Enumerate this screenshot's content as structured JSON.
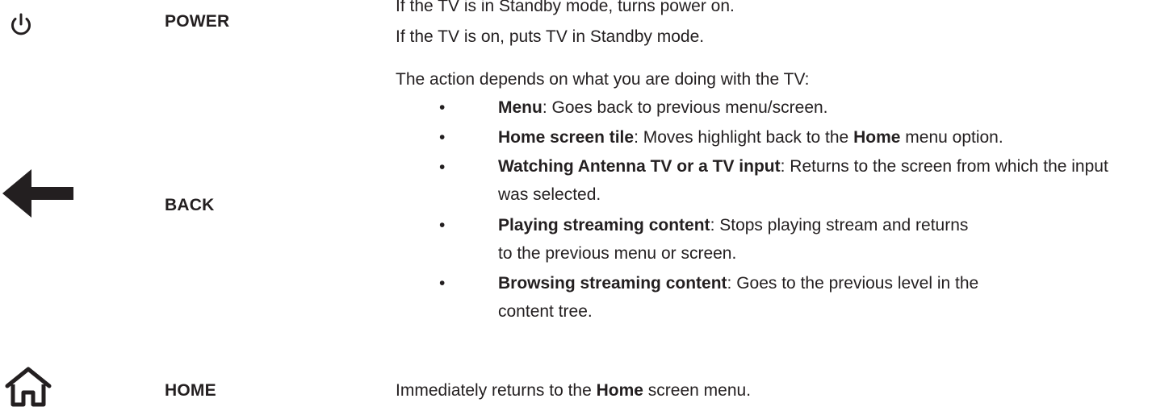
{
  "rows": {
    "power": {
      "icon": "power-icon",
      "label": "POWER",
      "lines": [
        "If the TV is in Standby mode, turns power on.",
        "If the TV is on, puts TV in Standby mode."
      ]
    },
    "back": {
      "icon": "left-arrow-icon",
      "label": "BACK",
      "intro": "The action depends on what you are doing with the TV:",
      "items": [
        {
          "bold": "Menu",
          "text": ": Goes back to previous menu/screen."
        },
        {
          "bold": "Home screen tile",
          "text": ": Moves highlight back to the ",
          "bold2": "Home",
          "text2": " menu option."
        },
        {
          "bold": "Watching Antenna TV or a TV input",
          "text": ": Returns to the screen from which the input was selected."
        },
        {
          "bold": "Playing streaming content",
          "text": ": Stops playing stream and returns to the previous menu or screen."
        },
        {
          "bold": "Browsing streaming content",
          "text": ": Goes to the previous level in the content tree."
        }
      ],
      "bullet": "•"
    },
    "home": {
      "icon": "home-icon",
      "label": "HOME",
      "pre": "Immediately returns to the ",
      "bold": "Home",
      "post": " screen menu."
    }
  }
}
